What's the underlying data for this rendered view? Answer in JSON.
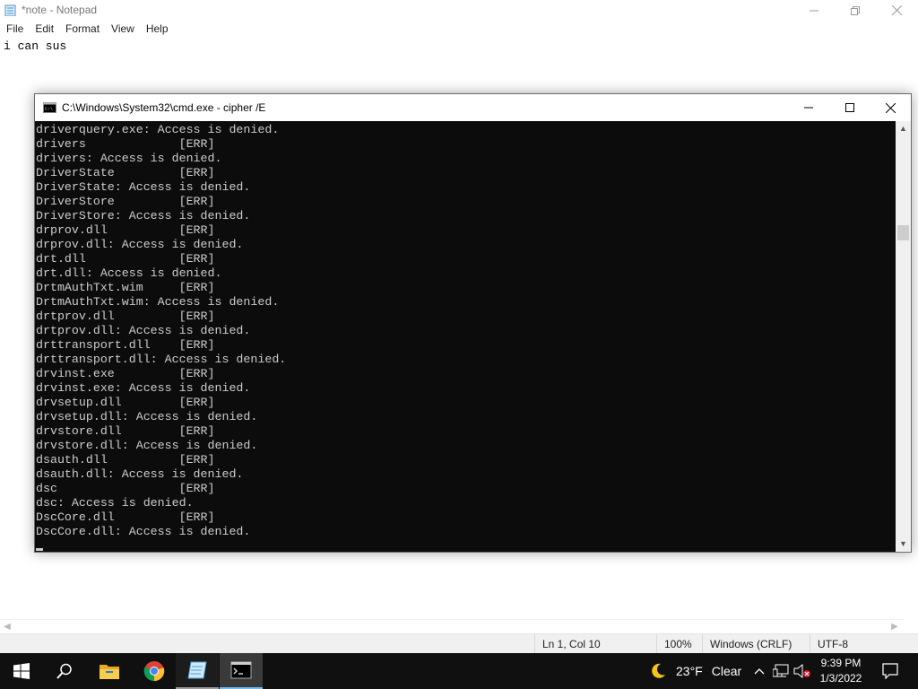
{
  "notepad": {
    "title": "*note - Notepad",
    "menu": [
      "File",
      "Edit",
      "Format",
      "View",
      "Help"
    ],
    "content": "i can sus",
    "status": {
      "position": "Ln 1, Col 10",
      "zoom": "100%",
      "line_endings": "Windows (CRLF)",
      "encoding": "UTF-8"
    }
  },
  "cmd": {
    "title": "C:\\Windows\\System32\\cmd.exe - cipher  /E",
    "lines": [
      "driverquery.exe: Access is denied.",
      "drivers             [ERR]",
      "drivers: Access is denied.",
      "DriverState         [ERR]",
      "DriverState: Access is denied.",
      "DriverStore         [ERR]",
      "DriverStore: Access is denied.",
      "drprov.dll          [ERR]",
      "drprov.dll: Access is denied.",
      "drt.dll             [ERR]",
      "drt.dll: Access is denied.",
      "DrtmAuthTxt.wim     [ERR]",
      "DrtmAuthTxt.wim: Access is denied.",
      "drtprov.dll         [ERR]",
      "drtprov.dll: Access is denied.",
      "drttransport.dll    [ERR]",
      "drttransport.dll: Access is denied.",
      "drvinst.exe         [ERR]",
      "drvinst.exe: Access is denied.",
      "drvsetup.dll        [ERR]",
      "drvsetup.dll: Access is denied.",
      "drvstore.dll        [ERR]",
      "drvstore.dll: Access is denied.",
      "dsauth.dll          [ERR]",
      "dsauth.dll: Access is denied.",
      "dsc                 [ERR]",
      "dsc: Access is denied.",
      "DscCore.dll         [ERR]",
      "DscCore.dll: Access is denied."
    ],
    "colors": {
      "background": "#0c0c0c",
      "text": "#cccccc"
    }
  },
  "taskbar": {
    "apps": [
      {
        "name": "start-icon"
      },
      {
        "name": "search-icon"
      },
      {
        "name": "file-explorer-icon"
      },
      {
        "name": "chrome-icon"
      },
      {
        "name": "notepad-icon"
      },
      {
        "name": "cmd-icon"
      }
    ],
    "weather": {
      "temp": "23°F",
      "condition": "Clear"
    },
    "clock": {
      "time": "9:39 PM",
      "date": "1/3/2022"
    },
    "accent": "#76b9ed"
  }
}
